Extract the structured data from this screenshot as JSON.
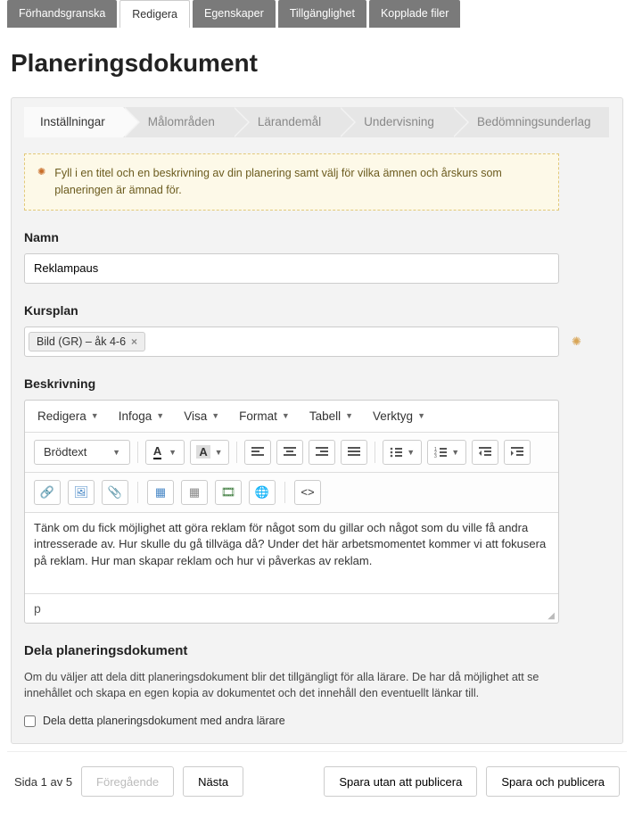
{
  "topTabs": {
    "preview": "Förhandsgranska",
    "edit": "Redigera",
    "properties": "Egenskaper",
    "accessibility": "Tillgänglighet",
    "attached": "Kopplade filer"
  },
  "pageTitle": "Planeringsdokument",
  "crumbs": {
    "settings": "Inställningar",
    "malomraden": "Målområden",
    "larandemal": "Lärandemål",
    "undervisning": "Undervisning",
    "bedomning": "Bedömningsunderlag"
  },
  "infoText": "Fyll i en titel och en beskrivning av din planering samt välj för vilka ämnen och årskurs som planeringen är ämnad för.",
  "fields": {
    "nameLabel": "Namn",
    "nameValue": "Reklampaus",
    "kursplanLabel": "Kursplan",
    "kursplanTag": "Bild  (GR) – åk 4-6",
    "beskrivningLabel": "Beskrivning"
  },
  "editor": {
    "menus": {
      "redigera": "Redigera",
      "infoga": "Infoga",
      "visa": "Visa",
      "format": "Format",
      "tabell": "Tabell",
      "verktyg": "Verktyg"
    },
    "styleSelect": "Brödtext",
    "content": "Tänk om du fick möjlighet att göra reklam för något som du gillar och något som du ville få andra intresserade av. Hur skulle du gå tillväga då? Under det här arbetsmomentet kommer vi att fokusera på reklam. Hur man skapar reklam och hur vi påverkas av reklam.",
    "path": "p"
  },
  "share": {
    "title": "Dela planeringsdokument",
    "desc": "Om du väljer att dela ditt planeringsdokument blir det tillgängligt för alla lärare. De har då möjlighet att se innehållet och skapa en egen kopia av dokumentet och det innehåll den eventuellt länkar till.",
    "checkbox": "Dela detta planeringsdokument med andra lärare"
  },
  "footer": {
    "pageIndicator": "Sida 1 av 5",
    "prev": "Föregående",
    "next": "Nästa",
    "saveDraft": "Spara utan att publicera",
    "publish": "Spara och publicera"
  }
}
